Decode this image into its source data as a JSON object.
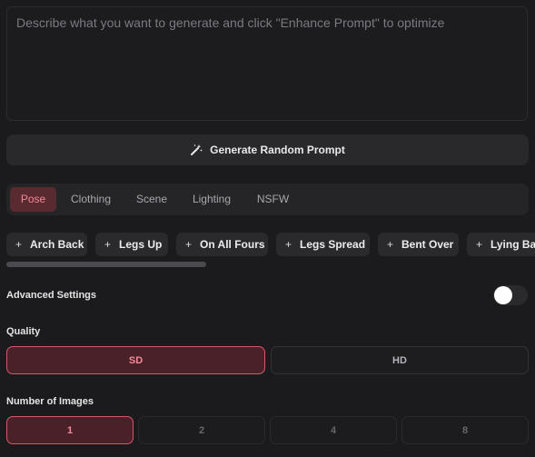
{
  "prompt": {
    "placeholder": "Describe what you want to generate and click \"Enhance Prompt\" to optimize",
    "value": ""
  },
  "generate_button": {
    "label": "Generate Random Prompt",
    "icon": "magic-wand-icon"
  },
  "tabs": [
    {
      "label": "Pose",
      "active": true
    },
    {
      "label": "Clothing",
      "active": false
    },
    {
      "label": "Scene",
      "active": false
    },
    {
      "label": "Lighting",
      "active": false
    },
    {
      "label": "NSFW",
      "active": false
    }
  ],
  "pose_chips": [
    {
      "label": "Arch Back",
      "icon": "plus-icon"
    },
    {
      "label": "Legs Up",
      "icon": "plus-icon"
    },
    {
      "label": "On All Fours",
      "icon": "plus-icon"
    },
    {
      "label": "Legs Spread",
      "icon": "plus-icon"
    },
    {
      "label": "Bent Over",
      "icon": "plus-icon"
    },
    {
      "label": "Lying Ba",
      "icon": "plus-icon"
    }
  ],
  "advanced_settings": {
    "label": "Advanced Settings",
    "enabled": false
  },
  "quality": {
    "label": "Quality",
    "options": [
      {
        "label": "SD",
        "selected": true
      },
      {
        "label": "HD",
        "selected": false
      }
    ]
  },
  "number_of_images": {
    "label": "Number of Images",
    "options": [
      {
        "label": "1",
        "selected": true
      },
      {
        "label": "2",
        "selected": false
      },
      {
        "label": "4",
        "selected": false
      },
      {
        "label": "8",
        "selected": false
      }
    ]
  },
  "colors": {
    "background": "#1b1b1d",
    "accent": "#d8566b",
    "accent_text": "#f28a9b",
    "active_tab_bg": "#5a2a31"
  }
}
